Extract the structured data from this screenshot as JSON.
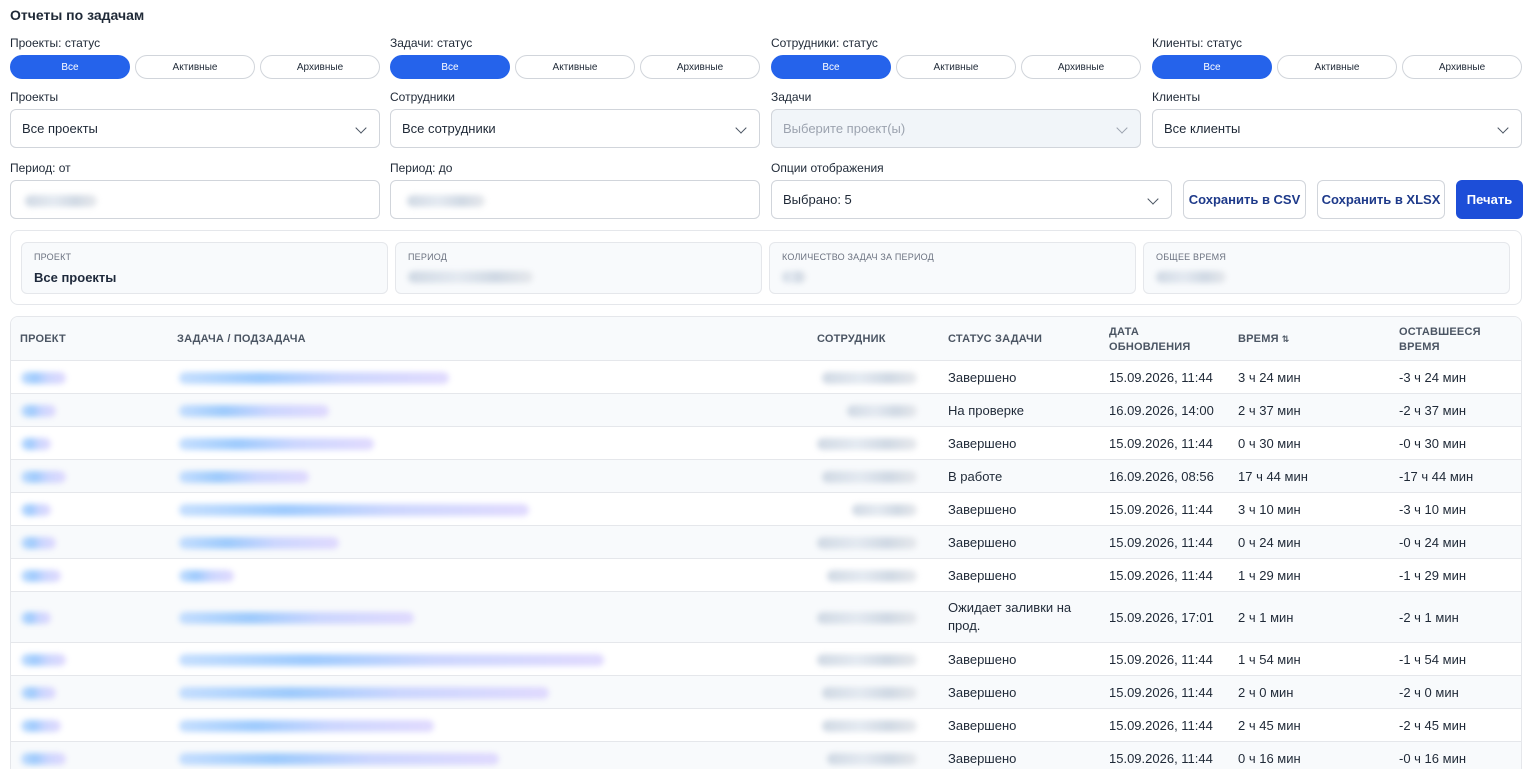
{
  "page_title": "Отчеты по задачам",
  "status_filters": [
    {
      "label": "Проекты: статус",
      "options": [
        "Все",
        "Активные",
        "Архивные"
      ],
      "selected": "Все"
    },
    {
      "label": "Задачи: статус",
      "options": [
        "Все",
        "Активные",
        "Архивные"
      ],
      "selected": "Все"
    },
    {
      "label": "Сотрудники: статус",
      "options": [
        "Все",
        "Активные",
        "Архивные"
      ],
      "selected": "Все"
    },
    {
      "label": "Клиенты: статус",
      "options": [
        "Все",
        "Активные",
        "Архивные"
      ],
      "selected": "Все"
    }
  ],
  "selects": [
    {
      "label": "Проекты",
      "value": "Все проекты",
      "disabled": false
    },
    {
      "label": "Сотрудники",
      "value": "Все сотрудники",
      "disabled": false
    },
    {
      "label": "Задачи",
      "value": "Выберите проект(ы)",
      "disabled": true
    },
    {
      "label": "Клиенты",
      "value": "Все клиенты",
      "disabled": false
    }
  ],
  "period_from": {
    "label": "Период: от",
    "value": ""
  },
  "period_to": {
    "label": "Период: до",
    "value": ""
  },
  "display_options": {
    "label": "Опции отображения",
    "value": "Выбрано: 5"
  },
  "actions": {
    "save_csv": "Сохранить в CSV",
    "save_xlsx": "Сохранить в XLSX",
    "print": "Печать"
  },
  "summary": {
    "project_label": "Проект",
    "project_value": "Все проекты",
    "period_label": "Период",
    "tasks_count_label": "Количество задач за период",
    "total_time_label": "Общее время"
  },
  "table": {
    "headers": {
      "project": "Проект",
      "task": "Задача / подзадача",
      "employee": "Сотрудник",
      "status": "Статус задачи",
      "updated": "Дата обновления",
      "time": "Время",
      "remaining": "Оставшееся время"
    },
    "rows": [
      {
        "status": "Завершено",
        "updated": "15.09.2026, 11:44",
        "time": "3 ч 24 мин",
        "remaining": "-3 ч 24 мин"
      },
      {
        "status": "На проверке",
        "updated": "16.09.2026, 14:00",
        "time": "2 ч 37 мин",
        "remaining": "-2 ч 37 мин"
      },
      {
        "status": "Завершено",
        "updated": "15.09.2026, 11:44",
        "time": "0 ч 30 мин",
        "remaining": "-0 ч 30 мин"
      },
      {
        "status": "В работе",
        "updated": "16.09.2026, 08:56",
        "time": "17 ч 44 мин",
        "remaining": "-17 ч 44 мин"
      },
      {
        "status": "Завершено",
        "updated": "15.09.2026, 11:44",
        "time": "3 ч 10 мин",
        "remaining": "-3 ч 10 мин"
      },
      {
        "status": "Завершено",
        "updated": "15.09.2026, 11:44",
        "time": "0 ч 24 мин",
        "remaining": "-0 ч 24 мин"
      },
      {
        "status": "Завершено",
        "updated": "15.09.2026, 11:44",
        "time": "1 ч 29 мин",
        "remaining": "-1 ч 29 мин"
      },
      {
        "status": "Ожидает заливки на прод.",
        "updated": "15.09.2026, 17:01",
        "time": "2 ч 1 мин",
        "remaining": "-2 ч 1 мин"
      },
      {
        "status": "Завершено",
        "updated": "15.09.2026, 11:44",
        "time": "1 ч 54 мин",
        "remaining": "-1 ч 54 мин"
      },
      {
        "status": "Завершено",
        "updated": "15.09.2026, 11:44",
        "time": "2 ч 0 мин",
        "remaining": "-2 ч 0 мин"
      },
      {
        "status": "Завершено",
        "updated": "15.09.2026, 11:44",
        "time": "2 ч 45 мин",
        "remaining": "-2 ч 45 мин"
      },
      {
        "status": "Завершено",
        "updated": "15.09.2026, 11:44",
        "time": "0 ч 16 мин",
        "remaining": "-0 ч 16 мин"
      }
    ]
  }
}
